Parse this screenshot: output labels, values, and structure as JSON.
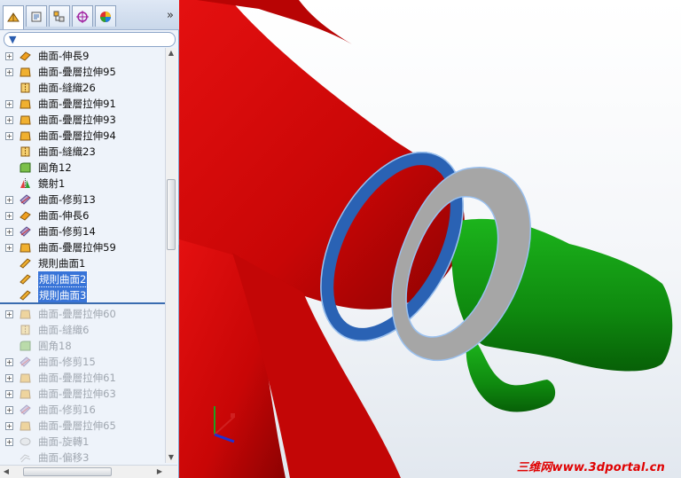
{
  "tabs": [
    {
      "name": "feature-manager-tab-icon",
      "active": true
    },
    {
      "name": "property-manager-tab-icon",
      "active": false
    },
    {
      "name": "configuration-manager-tab-icon",
      "active": false
    },
    {
      "name": "dimxpert-manager-tab-icon",
      "active": false
    },
    {
      "name": "display-manager-tab-icon",
      "active": false
    }
  ],
  "tab_more": "»",
  "tree": [
    {
      "label": "曲面-伸長9",
      "icon": "surface-extrude-icon",
      "expandable": true,
      "state": "normal"
    },
    {
      "label": "曲面-疊層拉伸95",
      "icon": "surface-loft-icon",
      "expandable": true,
      "state": "normal"
    },
    {
      "label": "曲面-縫織26",
      "icon": "surface-knit-icon",
      "expandable": false,
      "state": "normal"
    },
    {
      "label": "曲面-疊層拉伸91",
      "icon": "surface-loft-icon",
      "expandable": true,
      "state": "normal"
    },
    {
      "label": "曲面-疊層拉伸93",
      "icon": "surface-loft-icon",
      "expandable": true,
      "state": "normal"
    },
    {
      "label": "曲面-疊層拉伸94",
      "icon": "surface-loft-icon",
      "expandable": true,
      "state": "normal"
    },
    {
      "label": "曲面-縫織23",
      "icon": "surface-knit-icon",
      "expandable": false,
      "state": "normal"
    },
    {
      "label": "圓角12",
      "icon": "fillet-icon",
      "expandable": false,
      "state": "normal"
    },
    {
      "label": "鏡射1",
      "icon": "mirror-icon",
      "expandable": false,
      "state": "normal"
    },
    {
      "label": "曲面-修剪13",
      "icon": "surface-trim-icon",
      "expandable": true,
      "state": "normal"
    },
    {
      "label": "曲面-伸長6",
      "icon": "surface-extrude-icon",
      "expandable": true,
      "state": "normal"
    },
    {
      "label": "曲面-修剪14",
      "icon": "surface-trim-icon",
      "expandable": true,
      "state": "normal"
    },
    {
      "label": "曲面-疊層拉伸59",
      "icon": "surface-loft-icon",
      "expandable": true,
      "state": "normal"
    },
    {
      "label": "規則曲面1",
      "icon": "ruled-surface-icon",
      "expandable": false,
      "state": "normal"
    },
    {
      "label": "規則曲面2",
      "icon": "ruled-surface-icon",
      "expandable": false,
      "state": "selected"
    },
    {
      "label": "規則曲面3",
      "icon": "ruled-surface-icon",
      "expandable": false,
      "state": "selected"
    },
    {
      "label": "曲面-疊層拉伸60",
      "icon": "surface-loft-icon",
      "expandable": true,
      "state": "suppressed"
    },
    {
      "label": "曲面-縫織6",
      "icon": "surface-knit-icon",
      "expandable": false,
      "state": "suppressed"
    },
    {
      "label": "圓角18",
      "icon": "fillet-icon",
      "expandable": false,
      "state": "suppressed"
    },
    {
      "label": "曲面-修剪15",
      "icon": "surface-trim-icon",
      "expandable": true,
      "state": "suppressed"
    },
    {
      "label": "曲面-疊層拉伸61",
      "icon": "surface-loft-icon",
      "expandable": true,
      "state": "suppressed"
    },
    {
      "label": "曲面-疊層拉伸63",
      "icon": "surface-loft-icon",
      "expandable": true,
      "state": "suppressed"
    },
    {
      "label": "曲面-修剪16",
      "icon": "surface-trim-icon",
      "expandable": true,
      "state": "suppressed"
    },
    {
      "label": "曲面-疊層拉伸65",
      "icon": "surface-loft-icon",
      "expandable": true,
      "state": "suppressed"
    },
    {
      "label": "曲面-旋轉1",
      "icon": "surface-revolve-icon",
      "expandable": true,
      "state": "suppressed"
    },
    {
      "label": "曲面-偏移3",
      "icon": "surface-offset-icon",
      "expandable": false,
      "state": "suppressed"
    }
  ],
  "watermark": "三维网www.3dportal.cn",
  "colors": {
    "body_red": "#d40808",
    "body_green": "#129612",
    "ring_blue": "#2a62b4",
    "ring_grey": "#a6a6a6",
    "selection": "#3874d8",
    "suppressed_text": "#a0a7b0"
  }
}
